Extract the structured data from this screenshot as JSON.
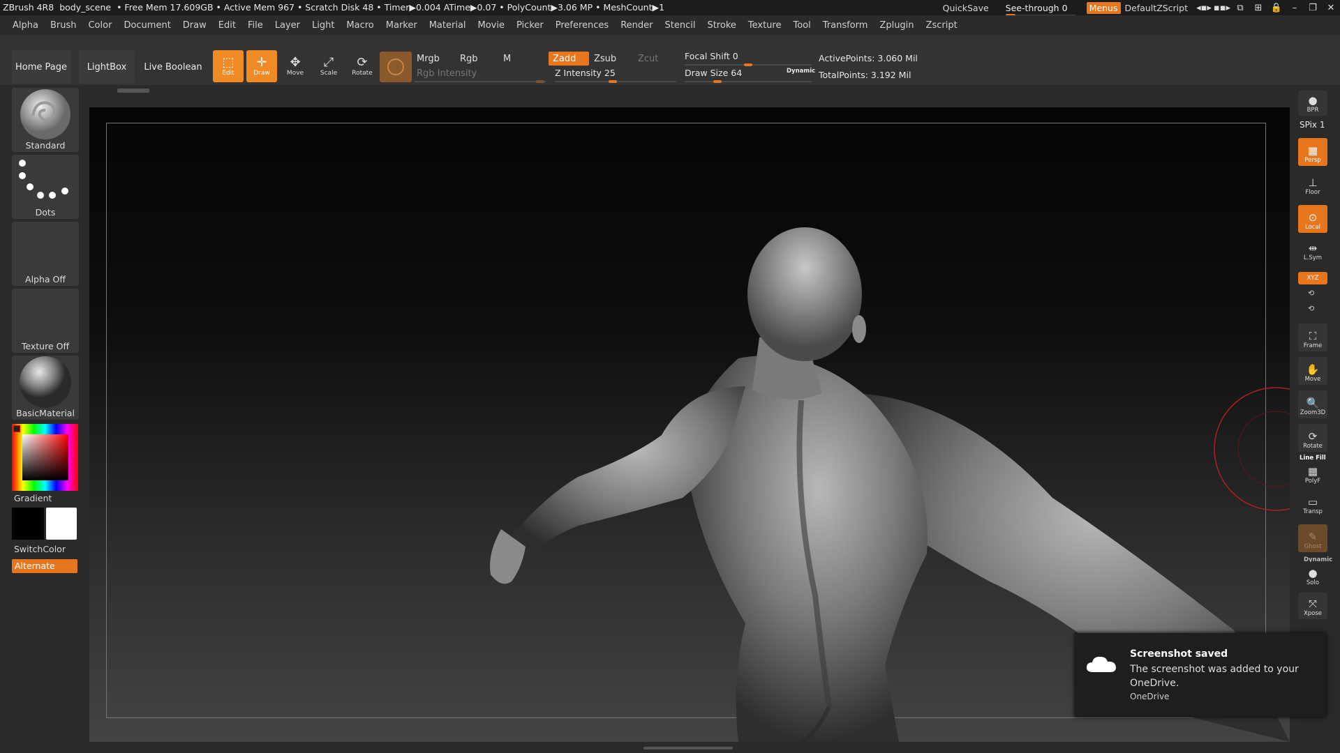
{
  "titlebar": {
    "app": "ZBrush 4R8",
    "project": "body_scene",
    "stats": "• Free Mem 17.609GB • Active Mem 967 • Scratch Disk 48 •  Timer▶0.004 ATime▶0.07 • PolyCount▶3.06 MP  • MeshCount▶1",
    "quicksave": "QuickSave",
    "seethrough": "See-through  0",
    "menus": "Menus",
    "script": "DefaultZScript"
  },
  "menu": [
    "Alpha",
    "Brush",
    "Color",
    "Document",
    "Draw",
    "Edit",
    "File",
    "Layer",
    "Light",
    "Macro",
    "Marker",
    "Material",
    "Movie",
    "Picker",
    "Preferences",
    "Render",
    "Stencil",
    "Stroke",
    "Texture",
    "Tool",
    "Transform",
    "Zplugin",
    "Zscript"
  ],
  "toolbar": {
    "home": "Home Page",
    "lightbox": "LightBox",
    "liveboolean": "Live Boolean",
    "edit": "Edit",
    "draw": "Draw",
    "move": "Move",
    "scale": "Scale",
    "rotate": "Rotate",
    "mrgb": "Mrgb",
    "rgb": "Rgb",
    "m": "M",
    "zadd": "Zadd",
    "zsub": "Zsub",
    "zcut": "Zcut",
    "rgb_intensity": "Rgb Intensity",
    "z_intensity": "Z Intensity 25",
    "focal_shift": "Focal Shift 0",
    "draw_size": "Draw Size 64",
    "dynamic": "Dynamic",
    "active_points": "ActivePoints: 3.060 Mil",
    "total_points": "TotalPoints: 3.192 Mil"
  },
  "left": {
    "brush": "Standard",
    "stroke": "Dots",
    "alpha": "Alpha Off",
    "texture": "Texture Off",
    "material": "BasicMaterial",
    "gradient": "Gradient",
    "switchcolor": "SwitchColor",
    "alternate": "Alternate"
  },
  "right": {
    "bpr": "BPR",
    "spix": "SPix 1",
    "persp": "Persp",
    "floor": "Floor",
    "local": "Local",
    "lsym": "L.Sym",
    "xyz": "XYZ",
    "frame": "Frame",
    "move": "Move",
    "zoom3d": "Zoom3D",
    "rotate": "Rotate",
    "linefill": "Line Fill",
    "polyf": "PolyF",
    "transp": "Transp",
    "ghost": "Ghost",
    "dynamic": "Dynamic",
    "solo": "Solo",
    "xpose": "Xpose"
  },
  "toast": {
    "title": "Screenshot saved",
    "body": "The screenshot was added to your OneDrive.",
    "source": "OneDrive"
  }
}
